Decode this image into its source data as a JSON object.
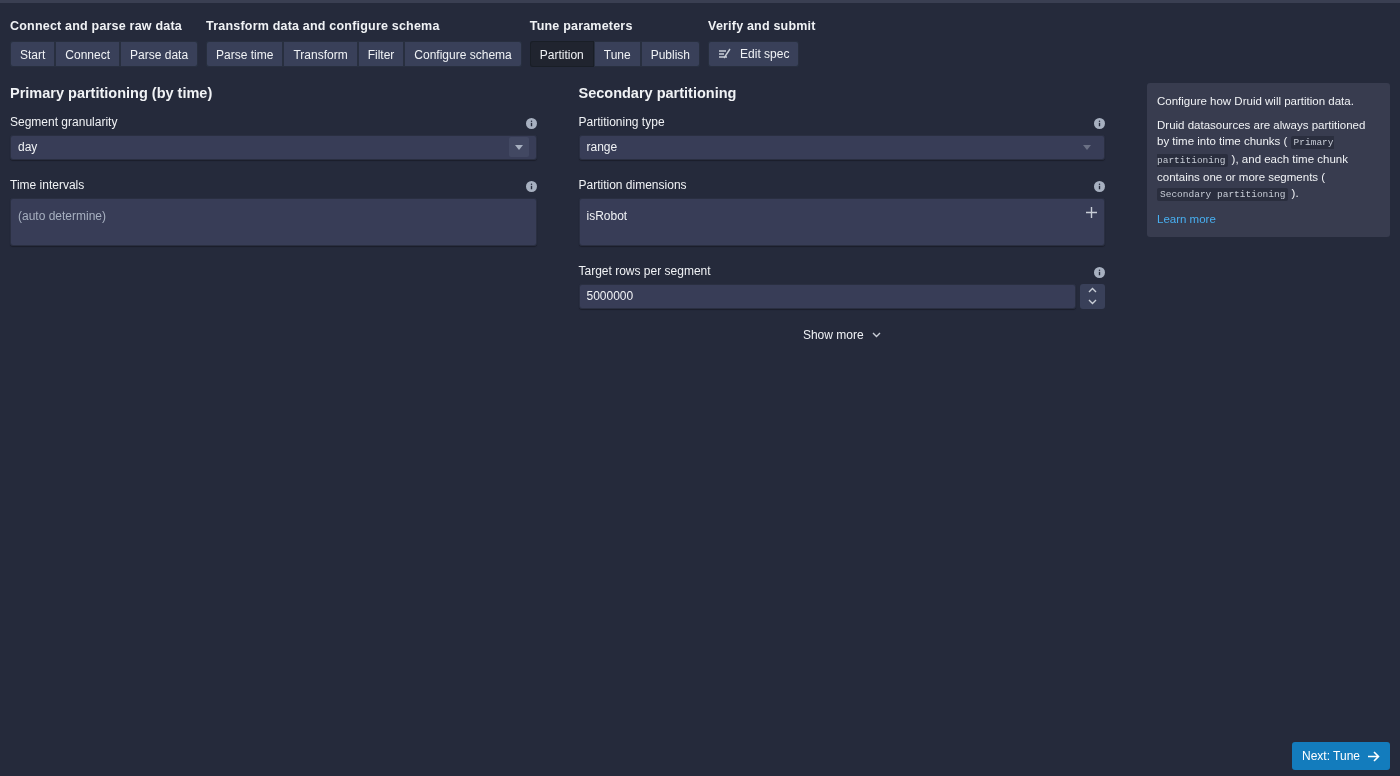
{
  "steps": [
    {
      "group": "Connect and parse raw data",
      "items": [
        {
          "label": "Start",
          "selected": false
        },
        {
          "label": "Connect",
          "selected": false
        },
        {
          "label": "Parse data",
          "selected": false
        }
      ]
    },
    {
      "group": "Transform data and configure schema",
      "items": [
        {
          "label": "Parse time",
          "selected": false
        },
        {
          "label": "Transform",
          "selected": false
        },
        {
          "label": "Filter",
          "selected": false
        },
        {
          "label": "Configure schema",
          "selected": false
        }
      ]
    },
    {
      "group": "Tune parameters",
      "items": [
        {
          "label": "Partition",
          "selected": true
        },
        {
          "label": "Tune",
          "selected": false
        },
        {
          "label": "Publish",
          "selected": false
        }
      ]
    },
    {
      "group": "Verify and submit",
      "items": [
        {
          "label": "Edit spec",
          "selected": false,
          "icon": true
        }
      ]
    }
  ],
  "primary": {
    "title": "Primary partitioning (by time)",
    "fields": [
      {
        "kind": "select",
        "label": "Segment granularity",
        "value": "day"
      },
      {
        "kind": "textarea",
        "label": "Time intervals",
        "placeholder": "(auto determine)"
      }
    ]
  },
  "secondary": {
    "title": "Secondary partitioning",
    "fields": [
      {
        "kind": "select",
        "label": "Partitioning type",
        "value": "range",
        "disabled": true
      },
      {
        "kind": "tags",
        "label": "Partition dimensions",
        "value": "isRobot"
      },
      {
        "kind": "numeric",
        "label": "Target rows per segment",
        "value": "5000000"
      }
    ],
    "show_more": "Show more"
  },
  "info": {
    "intro": "Configure how Druid will partition data.",
    "parts": [
      {
        "kind": "text",
        "text": "Druid datasources are always partitioned by time into time chunks ( "
      },
      {
        "kind": "code",
        "text": "Primary partitioning"
      },
      {
        "kind": "text",
        "text": " ), and each time chunk contains one or more segments ( "
      },
      {
        "kind": "code",
        "text": "Secondary partitioning"
      },
      {
        "kind": "text",
        "text": " )."
      }
    ],
    "link": "Learn more"
  },
  "next_button": "Next: Tune"
}
